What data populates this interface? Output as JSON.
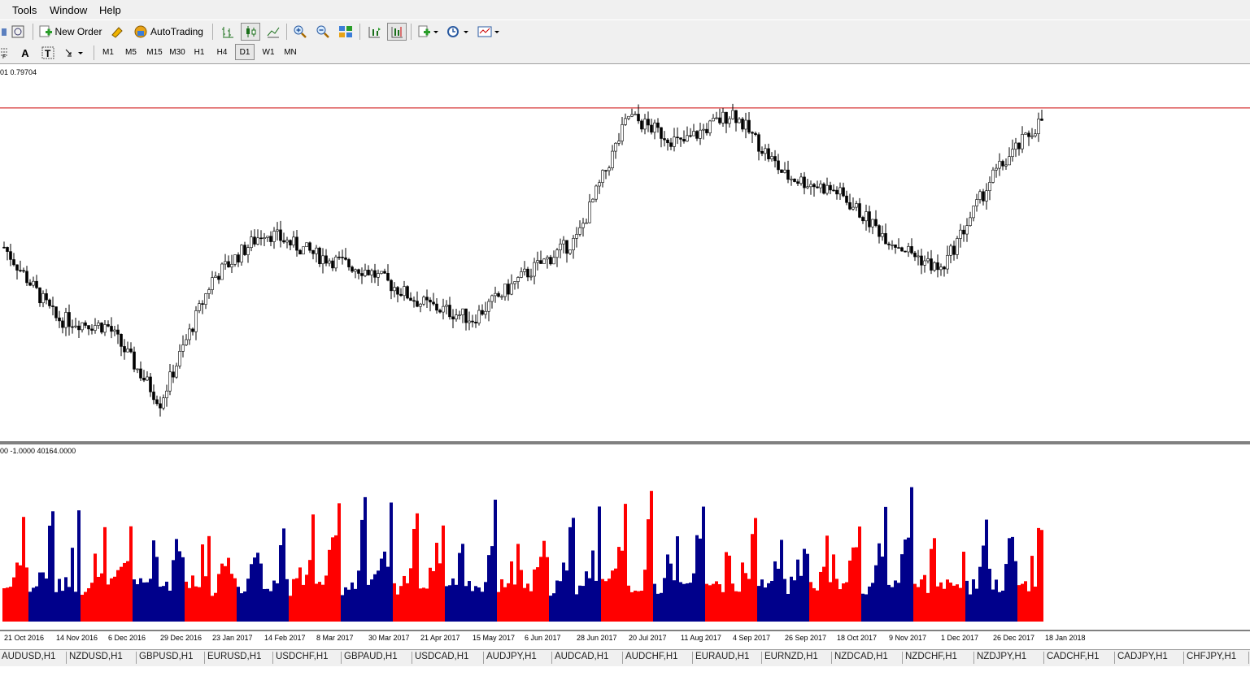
{
  "menu": [
    "Tools",
    "Window",
    "Help"
  ],
  "toolbar": {
    "new_order": "New Order",
    "auto_trading": "AutoTrading"
  },
  "timeframes": [
    "M1",
    "M5",
    "M15",
    "M30",
    "H1",
    "H4",
    "D1",
    "W1",
    "MN"
  ],
  "active_timeframe": "D1",
  "chart": {
    "header": "01 0.79704",
    "price_line_color": "#cc0000",
    "bull_color": "#000000",
    "bear_color": "#000000",
    "volume_header": "00 -1.0000 40164.0000",
    "volume_colors": {
      "up": "#ff0000",
      "down": "#00008b"
    }
  },
  "dates": [
    "21 Oct 2016",
    "14 Nov 2016",
    "6 Dec 2016",
    "29 Dec 2016",
    "23 Jan 2017",
    "14 Feb 2017",
    "8 Mar 2017",
    "30 Mar 2017",
    "21 Apr 2017",
    "15 May 2017",
    "6 Jun 2017",
    "28 Jun 2017",
    "20 Jul 2017",
    "11 Aug 2017",
    "4 Sep 2017",
    "26 Sep 2017",
    "18 Oct 2017",
    "9 Nov 2017",
    "1 Dec 2017",
    "26 Dec 2017",
    "18 Jan 2018"
  ],
  "symbol_tabs": [
    "AUDUSD,H1",
    "NZDUSD,H1",
    "GBPUSD,H1",
    "EURUSD,H1",
    "USDCHF,H1",
    "GBPAUD,H1",
    "USDCAD,H1",
    "AUDJPY,H1",
    "AUDCAD,H1",
    "AUDCHF,H1",
    "EURAUD,H1",
    "EURNZD,H1",
    "NZDCAD,H1",
    "NZDCHF,H1",
    "NZDJPY,H1",
    "CADCHF,H1",
    "CADJPY,H1",
    "CHFJPY,H1"
  ],
  "chart_data": {
    "type": "candlestick",
    "x": [
      "21 Oct 2016",
      "14 Nov 2016",
      "6 Dec 2016",
      "29 Dec 2016",
      "23 Jan 2017",
      "14 Feb 2017",
      "8 Mar 2017",
      "30 Mar 2017",
      "21 Apr 2017",
      "15 May 2017",
      "6 Jun 2017",
      "28 Jun 2017",
      "20 Jul 2017",
      "11 Aug 2017",
      "4 Sep 2017",
      "26 Sep 2017",
      "18 Oct 2017",
      "9 Nov 2017",
      "1 Dec 2017",
      "26 Dec 2017",
      "18 Jan 2018"
    ],
    "close": [
      0.762,
      0.744,
      0.742,
      0.723,
      0.754,
      0.766,
      0.76,
      0.756,
      0.748,
      0.744,
      0.755,
      0.764,
      0.795,
      0.788,
      0.796,
      0.78,
      0.776,
      0.764,
      0.756,
      0.78,
      0.795
    ],
    "ylim": [
      0.715,
      0.805
    ],
    "price_line": 0.79704,
    "volume": {
      "ylim": [
        -1.0,
        40164.0
      ]
    }
  }
}
